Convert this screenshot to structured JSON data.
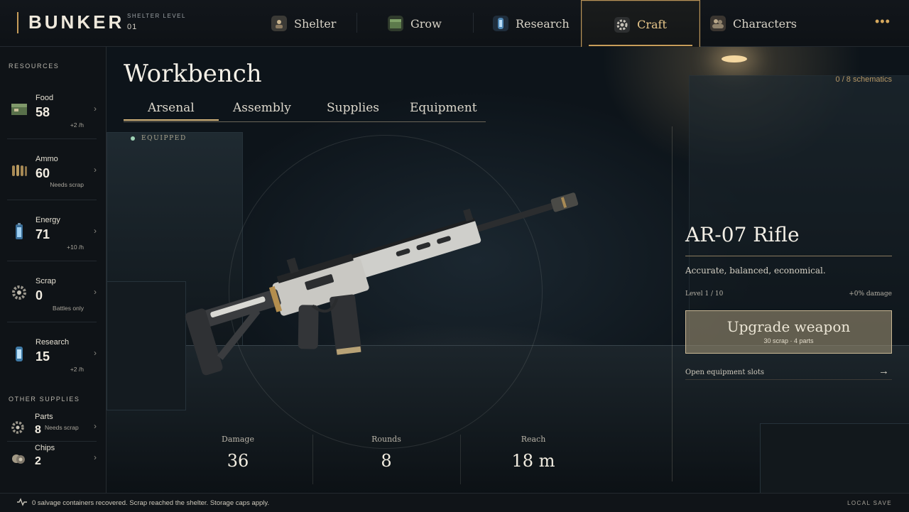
{
  "app": {
    "brand": "BUNKER",
    "shelter_level_label": "SHELTER LEVEL",
    "shelter_level_value": "01"
  },
  "nav": {
    "tabs": [
      {
        "label": "Shelter",
        "icon": "shelter-icon"
      },
      {
        "label": "Grow",
        "icon": "grow-crate-icon"
      },
      {
        "label": "Research",
        "icon": "research-vial-icon"
      },
      {
        "label": "Craft",
        "icon": "craft-gear-icon",
        "active": true
      },
      {
        "label": "Characters",
        "icon": "characters-icon"
      }
    ],
    "more": "•••"
  },
  "sidebar": {
    "resources_heading": "RESOURCES",
    "resources": [
      {
        "name": "Food",
        "value": "58",
        "sub": "+2 /h",
        "icon": "food-crate-icon"
      },
      {
        "name": "Ammo",
        "value": "60",
        "sub": "Needs scrap",
        "icon": "ammo-icon"
      },
      {
        "name": "Energy",
        "value": "71",
        "sub": "+10 /h",
        "icon": "battery-icon"
      },
      {
        "name": "Scrap",
        "value": "0",
        "sub": "Battles only",
        "icon": "scrap-gear-icon"
      },
      {
        "name": "Research",
        "value": "15",
        "sub": "+2 /h",
        "icon": "research-vial-icon"
      }
    ],
    "supplies_heading": "OTHER SUPPLIES",
    "supplies": [
      {
        "name": "Parts",
        "value": "8",
        "sub": "Needs scrap",
        "icon": "parts-gear-icon"
      },
      {
        "name": "Chips",
        "value": "2",
        "sub": "",
        "icon": "chips-icon"
      }
    ]
  },
  "workbench": {
    "title": "Workbench",
    "schematics": "0 / 8 schematics",
    "tabs": [
      "Arsenal",
      "Assembly",
      "Supplies",
      "Equipment"
    ],
    "active_tab": "Arsenal",
    "equipped_label": "EQUIPPED",
    "stats": [
      {
        "label": "Damage",
        "value": "36"
      },
      {
        "label": "Rounds",
        "value": "8"
      },
      {
        "label": "Reach",
        "value": "18 m"
      }
    ]
  },
  "weapon": {
    "name": "AR-07 Rifle",
    "description": "Accurate, balanced, economical.",
    "level": "Level 1 / 10",
    "damage_bonus": "+0% damage",
    "upgrade_label": "Upgrade weapon",
    "upgrade_cost": "30 scrap · 4 parts",
    "slots_label": "Open equipment slots",
    "slots_arrow": "→"
  },
  "status": {
    "message": "0 salvage containers recovered. Scrap reached the shelter. Storage caps apply.",
    "save": "LOCAL SAVE"
  },
  "colors": {
    "accent": "#c79d5a",
    "equipped_dot": "#9fd3b6"
  }
}
